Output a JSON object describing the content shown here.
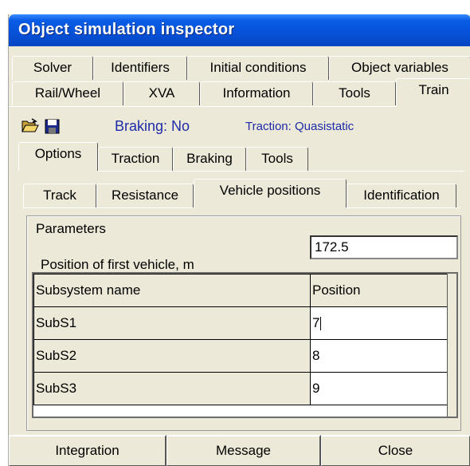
{
  "window": {
    "title": "Object simulation inspector"
  },
  "tabs_row1": [
    "Solver",
    "Identifiers",
    "Initial conditions",
    "Object variables"
  ],
  "tabs_row2": [
    "Rail/Wheel",
    "XVA",
    "Information",
    "Tools",
    "Train"
  ],
  "toolbar": {
    "open_icon": "folder-open-icon",
    "save_icon": "floppy-disk-icon",
    "braking_status": "Braking: No",
    "traction_status": "Traction: Quasistatic"
  },
  "subtabs": [
    "Options",
    "Traction",
    "Braking",
    "Tools"
  ],
  "inner_tabs": [
    "Track",
    "Resistance",
    "Vehicle positions",
    "Identification"
  ],
  "parameters": {
    "group_label": "Parameters",
    "first_vehicle_label": "Position of first vehicle, m",
    "first_vehicle_value": "172.5"
  },
  "grid": {
    "headers": [
      "Subsystem name",
      "Position"
    ],
    "rows": [
      [
        "SubS1",
        "7"
      ],
      [
        "SubS2",
        "8"
      ],
      [
        "SubS3",
        "9"
      ]
    ]
  },
  "buttons": [
    "Integration",
    "Message",
    "Close"
  ]
}
